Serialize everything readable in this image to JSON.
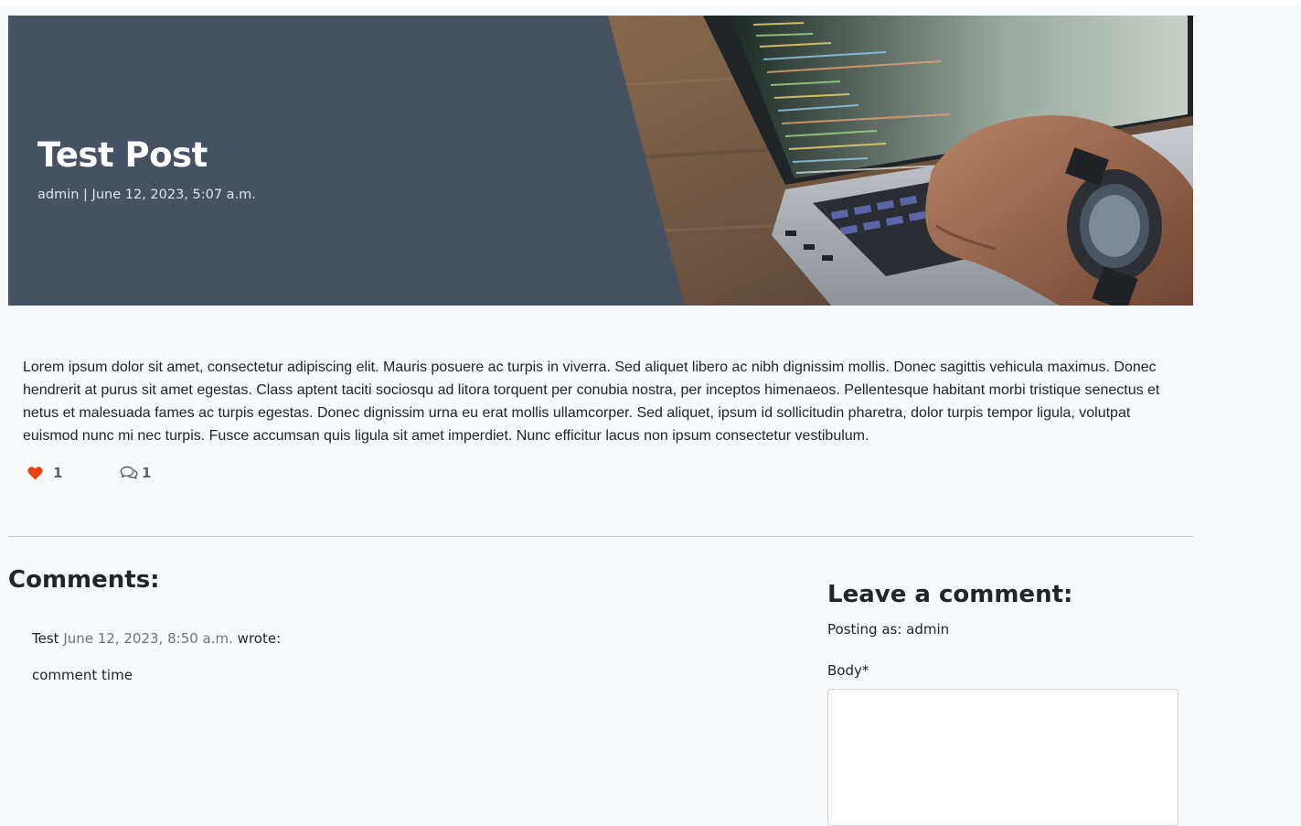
{
  "post": {
    "title": "Test Post",
    "meta": "admin | June 12, 2023, 5:07 a.m.",
    "body": "Lorem ipsum dolor sit amet, consectetur adipiscing elit. Mauris posuere ac turpis in viverra. Sed aliquet libero ac nibh dignissim mollis. Donec sagittis vehicula maximus. Donec hendrerit at purus sit amet egestas. Class aptent taciti sociosqu ad litora torquent per conubia nostra, per inceptos himenaeos. Pellentesque habitant morbi tristique senectus et netus et malesuada fames ac turpis egestas. Donec dignissim urna eu erat mollis ullamcorper. Sed aliquet, ipsum id sollicitudin pharetra, dolor turpis tempor ligula, volutpat euismod nunc mi nec turpis. Fusce accumsan quis ligula sit amet imperdiet. Nunc efficitur lacus non ipsum consectetur vestibulum.",
    "like_count": "1",
    "comment_count": "1",
    "like_icon": "heart-icon",
    "comment_icon": "comments-icon",
    "like_color": "#e8420f"
  },
  "comments": {
    "heading": "Comments:",
    "items": [
      {
        "author": "Test",
        "date": "June 12, 2023, 8:50 a.m.",
        "wrote": "wrote:",
        "body": "comment time"
      }
    ]
  },
  "comment_form": {
    "heading": "Leave a comment:",
    "posting_as": "Posting as: admin",
    "body_label": "Body*",
    "body_value": ""
  },
  "colors": {
    "hero_overlay": "#465161",
    "page_background": "#f8f9fa"
  }
}
